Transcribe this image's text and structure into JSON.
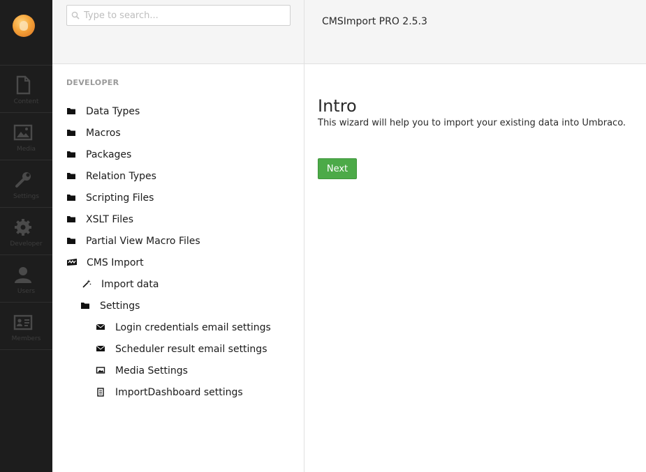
{
  "rail": {
    "items": [
      {
        "label": "Content",
        "icon": "content-icon"
      },
      {
        "label": "Media",
        "icon": "media-icon"
      },
      {
        "label": "Settings",
        "icon": "settings-icon"
      },
      {
        "label": "Developer",
        "icon": "developer-icon"
      },
      {
        "label": "Users",
        "icon": "users-icon"
      },
      {
        "label": "Members",
        "icon": "members-icon"
      }
    ]
  },
  "search": {
    "placeholder": "Type to search...",
    "value": ""
  },
  "header": {
    "title": "CMSImport PRO 2.5.3"
  },
  "tree": {
    "section_title": "DEVELOPER",
    "items": [
      {
        "label": "Data Types",
        "icon": "folder-icon"
      },
      {
        "label": "Macros",
        "icon": "folder-icon"
      },
      {
        "label": "Packages",
        "icon": "folder-icon"
      },
      {
        "label": "Relation Types",
        "icon": "folder-icon"
      },
      {
        "label": "Scripting Files",
        "icon": "folder-icon"
      },
      {
        "label": "XSLT Files",
        "icon": "folder-icon"
      },
      {
        "label": "Partial View Macro Files",
        "icon": "folder-icon"
      },
      {
        "label": "CMS Import",
        "icon": "cmsimport-logo-icon"
      },
      {
        "label": "Import data",
        "icon": "magic-wand-icon"
      },
      {
        "label": "Settings",
        "icon": "folder-icon"
      },
      {
        "label": "Login credentials email settings",
        "icon": "envelope-icon"
      },
      {
        "label": "Scheduler result email settings",
        "icon": "envelope-icon"
      },
      {
        "label": "Media Settings",
        "icon": "picture-icon"
      },
      {
        "label": "ImportDashboard settings",
        "icon": "notepad-icon"
      }
    ]
  },
  "main": {
    "title": "Intro",
    "description": "This wizard will help you to import your existing data into Umbraco.",
    "next_label": "Next"
  },
  "colors": {
    "rail_bg": "#1d1d1d",
    "header_bg": "#f5f5f5",
    "next_button": "#4caa48"
  }
}
